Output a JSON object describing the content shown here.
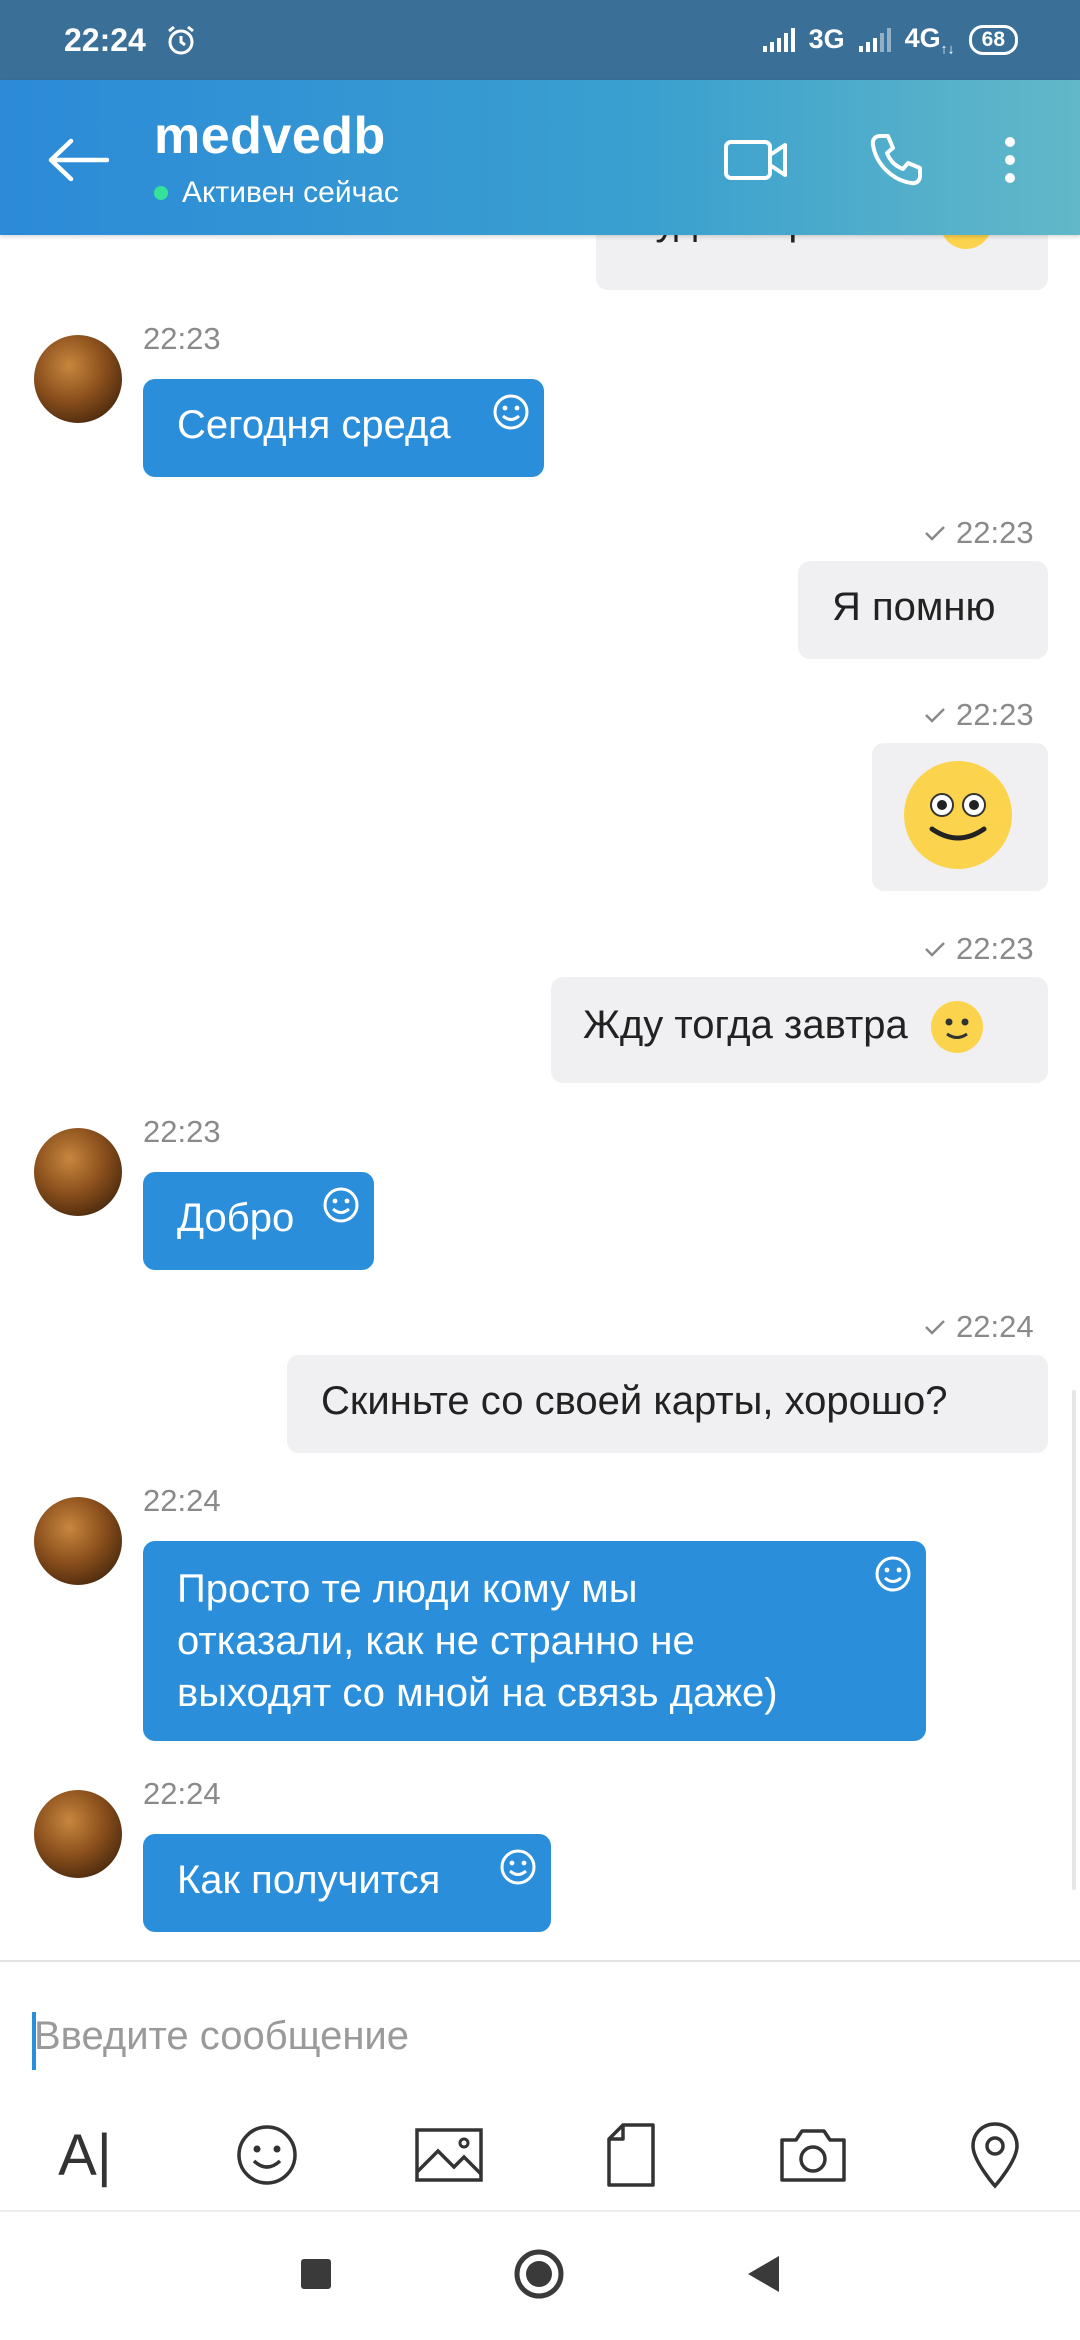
{
  "status_bar": {
    "time": "22:24",
    "network_1": "3G",
    "network_2": "4G",
    "network_2_sub": "↑↓",
    "battery": "68"
  },
  "header": {
    "title": "medvedb",
    "presence": "Активен сейчас"
  },
  "messages": [
    {
      "dir": "out",
      "text": "Будет зарплата",
      "emoji": "slight-smile"
    },
    {
      "dir": "in",
      "time": "22:23",
      "text": "Сегодня среда"
    },
    {
      "dir": "out",
      "time": "22:23",
      "text": "Я помню"
    },
    {
      "dir": "out",
      "time": "22:23",
      "emoji": "big-smile"
    },
    {
      "dir": "out",
      "time": "22:23",
      "text": "Жду тогда завтра",
      "emoji": "slight-smile"
    },
    {
      "dir": "in",
      "time": "22:23",
      "text": "Добро"
    },
    {
      "dir": "out",
      "time": "22:24",
      "text": "Скиньте со своей карты, хорошо?"
    },
    {
      "dir": "in",
      "time": "22:24",
      "lines": [
        "Просто те люди кому мы",
        "отказали, как не странно не",
        "выходят со мной на связь даже)"
      ]
    },
    {
      "dir": "in",
      "time": "22:24",
      "text": "Как получится"
    }
  ],
  "composer": {
    "placeholder": "Введите сообщение"
  },
  "toolbar": {
    "format_label": "A|",
    "icons": [
      "text-format-icon",
      "emoji-icon",
      "image-icon",
      "file-icon",
      "camera-icon",
      "location-icon"
    ]
  },
  "colors": {
    "accent": "#2b8edb",
    "header_start": "#2c8ad8",
    "header_end": "#62b8c8",
    "online": "#35e29a",
    "outgoing_bubble": "#f0f0f2"
  }
}
